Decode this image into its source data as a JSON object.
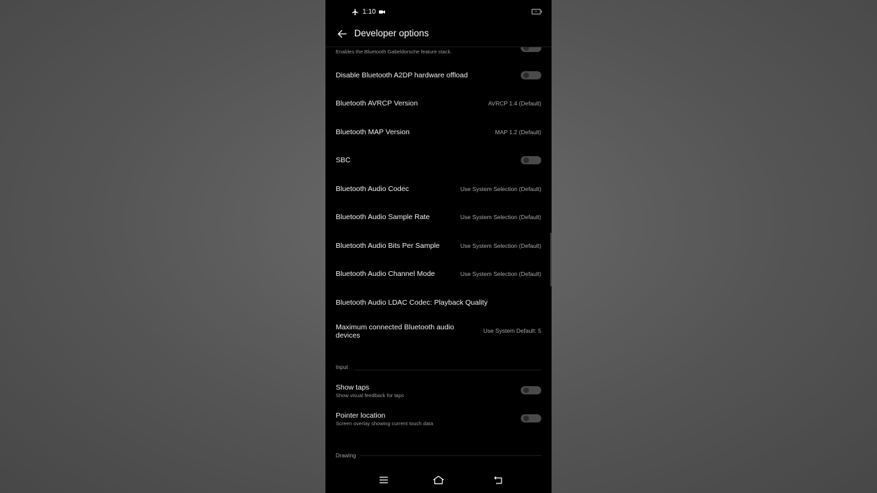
{
  "status_bar": {
    "time": "1:10",
    "battery_level": "91"
  },
  "header": {
    "title": "Developer options"
  },
  "items": [
    {
      "id": "gabeldorsche",
      "title": "",
      "subtitle": "Enables the Bluetooth Gabeldorsche feature stack.",
      "control": "toggle",
      "enabled": false
    },
    {
      "id": "a2dp-offload",
      "title": "Disable Bluetooth A2DP hardware offload",
      "control": "toggle",
      "enabled": false
    },
    {
      "id": "avrcp",
      "title": "Bluetooth AVRCP Version",
      "value": "AVRCP 1.4 (Default)"
    },
    {
      "id": "map",
      "title": "Bluetooth MAP Version",
      "value": "MAP 1.2 (Default)"
    },
    {
      "id": "sbc",
      "title": "SBC",
      "control": "toggle",
      "enabled": false
    },
    {
      "id": "codec",
      "title": "Bluetooth Audio Codec",
      "value": "Use System Selection (Default)"
    },
    {
      "id": "sample-rate",
      "title": "Bluetooth Audio Sample Rate",
      "value": "Use System Selection (Default)"
    },
    {
      "id": "bits",
      "title": "Bluetooth Audio Bits Per Sample",
      "value": "Use System Selection (Default)"
    },
    {
      "id": "channel",
      "title": "Bluetooth Audio Channel Mode",
      "value": "Use System Selection (Default)"
    },
    {
      "id": "ldac",
      "title": "Bluetooth Audio LDAC Codec: Playback Quality"
    },
    {
      "id": "max-devices",
      "title": "Maximum connected Bluetooth audio devices",
      "value": "Use System Default: 5"
    }
  ],
  "sections": {
    "input": "Input",
    "drawing": "Drawing"
  },
  "input_items": [
    {
      "id": "show-taps",
      "title": "Show taps",
      "subtitle": "Show visual feedback for taps",
      "enabled": false
    },
    {
      "id": "pointer-location",
      "title": "Pointer location",
      "subtitle": "Screen overlay showing current touch data",
      "enabled": false
    }
  ],
  "icons": {
    "back": "arrow-left-icon",
    "airplane": "airplane-icon",
    "video": "video-camera-icon",
    "battery": "battery-icon",
    "nav_menu": "menu-icon",
    "nav_home": "home-icon",
    "nav_back": "back-icon"
  },
  "colors": {
    "background": "#000000",
    "toggle_off": "#4a4a4a",
    "value_text": "#a8a8a8"
  }
}
